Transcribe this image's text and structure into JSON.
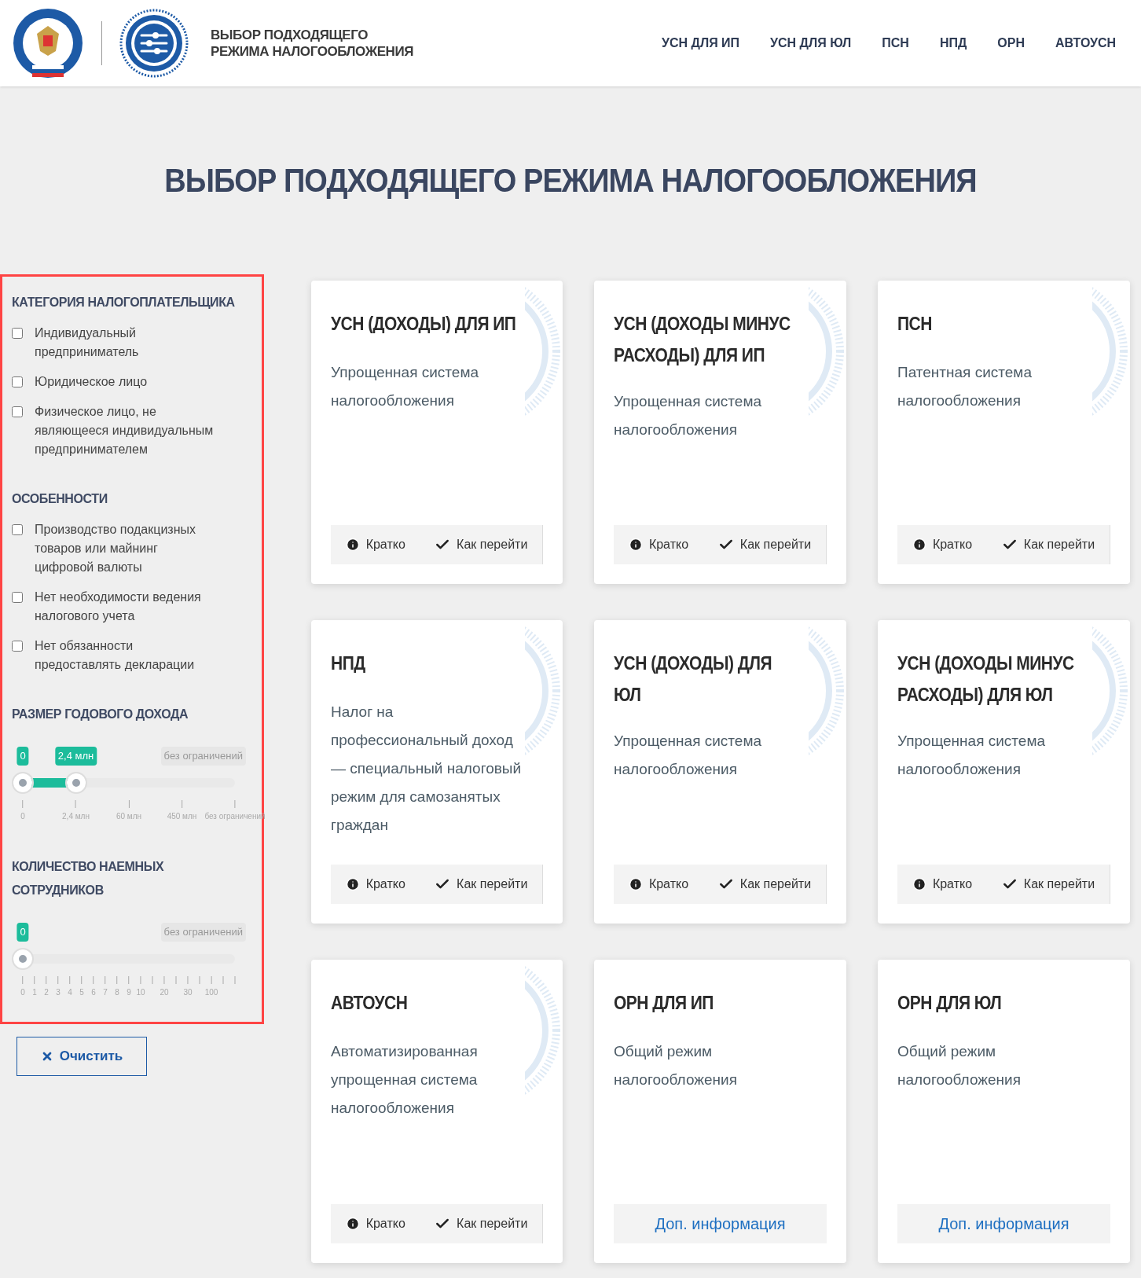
{
  "header": {
    "title_lines": [
      "ВЫБОР ПОДХОДЯЩЕГО",
      "РЕЖИМА НАЛОГООБЛОЖЕНИЯ"
    ],
    "nav": [
      {
        "label": "УСН ДЛЯ ИП"
      },
      {
        "label": "УСН ДЛЯ ЮЛ"
      },
      {
        "label": "ПСН"
      },
      {
        "label": "НПД"
      },
      {
        "label": "ОРН"
      },
      {
        "label": "АВТОУСН"
      }
    ]
  },
  "page_title": "ВЫБОР ПОДХОДЯЩЕГО РЕЖИМА НАЛОГООБЛОЖЕНИЯ",
  "sidebar": {
    "highlighted": true,
    "sections": [
      {
        "kind": "checkboxes",
        "title": "КАТЕГОРИЯ НАЛОГОПЛАТЕЛЬЩИКА",
        "items": [
          {
            "label": "Индивидуальный предприниматель",
            "checked": false
          },
          {
            "label": "Юридическое лицо",
            "checked": false
          },
          {
            "label": "Физическое лицо, не являющееся индивидуальным предпринимателем",
            "checked": false
          }
        ]
      },
      {
        "kind": "checkboxes",
        "title": "ОСОБЕННОСТИ",
        "items": [
          {
            "label": "Производство подакцизных товаров или майнинг цифровой валюты",
            "checked": false
          },
          {
            "label": "Нет необходимости ведения налогового учета",
            "checked": false
          },
          {
            "label": "Нет обязанности предоставлять декларации",
            "checked": false
          }
        ]
      },
      {
        "kind": "range",
        "title": "РАЗМЕР ГОДОВОГО ДОХОДА",
        "max_label": "без ограничений",
        "thumbs": [
          {
            "level": 0,
            "reading": "0"
          },
          {
            "level": 0.25,
            "reading": "2,4 млн"
          }
        ],
        "ticks": [
          {
            "kind": "labeled",
            "label": "0"
          },
          {
            "kind": "labeled",
            "label": "2,4 млн"
          },
          {
            "kind": "labeled",
            "label": "60 млн"
          },
          {
            "kind": "labeled",
            "label": "450 млн"
          },
          {
            "kind": "labeled",
            "label": "без ограничений"
          }
        ]
      },
      {
        "kind": "range",
        "title": "КОЛИЧЕСТВО НАЕМНЫХ СОТРУДНИКОВ",
        "max_label": "без ограничений",
        "thumbs": [
          {
            "level": 0,
            "reading": "0"
          }
        ],
        "ticks": [
          {
            "kind": "labeled",
            "label": "0"
          },
          {
            "kind": "labeled",
            "label": "1"
          },
          {
            "kind": "labeled",
            "label": "2"
          },
          {
            "kind": "labeled",
            "label": "3"
          },
          {
            "kind": "labeled",
            "label": "4"
          },
          {
            "kind": "labeled",
            "label": "5"
          },
          {
            "kind": "labeled",
            "label": "6"
          },
          {
            "kind": "labeled",
            "label": "7"
          },
          {
            "kind": "labeled",
            "label": "8"
          },
          {
            "kind": "labeled",
            "label": "9"
          },
          {
            "kind": "labeled",
            "label": "10"
          },
          {
            "kind": "plain"
          },
          {
            "kind": "labeled",
            "label": "20"
          },
          {
            "kind": "plain"
          },
          {
            "kind": "labeled",
            "label": "30"
          },
          {
            "kind": "plain"
          },
          {
            "kind": "labeled",
            "label": "100"
          },
          {
            "kind": "plain"
          },
          {
            "kind": "plain"
          }
        ]
      }
    ]
  },
  "clear_button": {
    "label": "Очистить"
  },
  "cards": [
    {
      "title": "УСН (ДОХОДЫ) ДЛЯ ИП",
      "emblem": true,
      "description": "Упрощенная система налогообложения",
      "footer": {
        "kind": "actions",
        "buttons": [
          {
            "label": "Кратко"
          },
          {
            "label": "Как перейти"
          }
        ]
      }
    },
    {
      "title": "УСН (ДОХОДЫ МИНУС РАСХОДЫ) ДЛЯ ИП",
      "emblem": true,
      "description": "Упрощенная система налогообложения",
      "footer": {
        "kind": "actions",
        "buttons": [
          {
            "label": "Кратко"
          },
          {
            "label": "Как перейти"
          }
        ]
      }
    },
    {
      "title": "ПСН",
      "emblem": true,
      "description": "Патентная система налогообложения",
      "footer": {
        "kind": "actions",
        "buttons": [
          {
            "label": "Кратко"
          },
          {
            "label": "Как перейти"
          }
        ]
      }
    },
    {
      "title": "НПД",
      "emblem": true,
      "description": "Налог на профессиональный доход — специальный налоговый режим для самозанятых граждан",
      "footer": {
        "kind": "actions",
        "buttons": [
          {
            "label": "Кратко"
          },
          {
            "label": "Как перейти"
          }
        ]
      }
    },
    {
      "title": "УСН (ДОХОДЫ) ДЛЯ ЮЛ",
      "emblem": true,
      "description": "Упрощенная система налогообложения",
      "footer": {
        "kind": "actions",
        "buttons": [
          {
            "label": "Кратко"
          },
          {
            "label": "Как перейти"
          }
        ]
      }
    },
    {
      "title": "УСН (ДОХОДЫ МИНУС РАСХОДЫ) ДЛЯ ЮЛ",
      "emblem": true,
      "description": "Упрощенная система налогообложения",
      "footer": {
        "kind": "actions",
        "buttons": [
          {
            "label": "Кратко"
          },
          {
            "label": "Как перейти"
          }
        ]
      }
    },
    {
      "title": "АВТОУСН",
      "emblem": true,
      "description": "Автоматизированная упрощенная система налогообложения",
      "footer": {
        "kind": "actions",
        "buttons": [
          {
            "label": "Кратко"
          },
          {
            "label": "Как перейти"
          }
        ]
      }
    },
    {
      "title": "ОРН ДЛЯ ИП",
      "description": "Общий режим налогообложения",
      "footer": {
        "kind": "link",
        "label": "Доп. информация"
      }
    },
    {
      "title": "ОРН ДЛЯ ЮЛ",
      "description": "Общий режим налогообложения",
      "footer": {
        "kind": "link",
        "label": "Доп. информация"
      }
    }
  ]
}
